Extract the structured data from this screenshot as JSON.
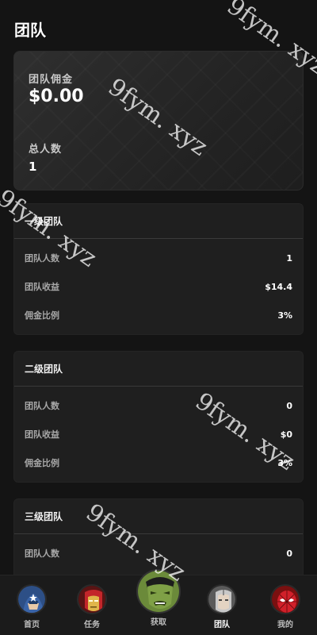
{
  "header": {
    "title": "团队"
  },
  "summary": {
    "commission_label": "团队佣金",
    "commission_value": "$0.00",
    "total_label": "总人数",
    "total_value": "1"
  },
  "levels": [
    {
      "title": "一级团队",
      "rows": [
        {
          "key": "团队人数",
          "value": "1"
        },
        {
          "key": "团队收益",
          "value": "$14.4"
        },
        {
          "key": "佣金比例",
          "value": "3%"
        }
      ]
    },
    {
      "title": "二级团队",
      "rows": [
        {
          "key": "团队人数",
          "value": "0"
        },
        {
          "key": "团队收益",
          "value": "$0"
        },
        {
          "key": "佣金比例",
          "value": "3%"
        }
      ]
    },
    {
      "title": "三级团队",
      "rows": [
        {
          "key": "团队人数",
          "value": "0"
        }
      ]
    }
  ],
  "tabbar": {
    "items": [
      {
        "label": "首页",
        "icon": "captain-america-icon"
      },
      {
        "label": "任务",
        "icon": "iron-man-icon"
      },
      {
        "label": "获取",
        "icon": "hulk-icon"
      },
      {
        "label": "团队",
        "icon": "ultron-icon"
      },
      {
        "label": "我的",
        "icon": "spider-man-icon"
      }
    ],
    "active": "团队"
  },
  "watermark": {
    "text": "9fym. xyz"
  }
}
